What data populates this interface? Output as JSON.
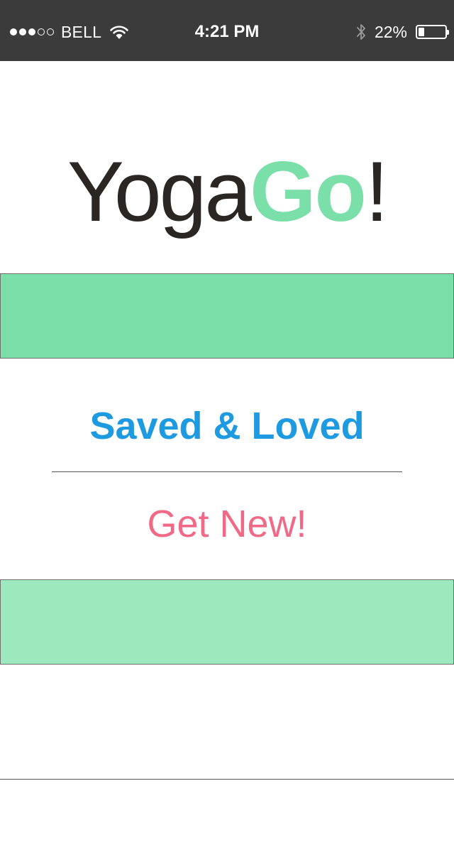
{
  "status_bar": {
    "signal_bars": 3,
    "signal_max": 5,
    "carrier": "BELL",
    "time": "4:21 PM",
    "battery_percent_label": "22%",
    "battery_level": 0.22,
    "icons": [
      "signal-icon",
      "wifi-icon",
      "bluetooth-icon",
      "battery-icon"
    ],
    "background_color": "#3b3b3b"
  },
  "logo": {
    "part1": "Yoga",
    "part2": "Go",
    "part3": "!",
    "text_color": "#2a2624",
    "accent_color": "#7adfa8"
  },
  "banners": {
    "top_color": "#7adfa8",
    "bottom_color": "#9ee8be"
  },
  "menu": {
    "saved_loved_label": "Saved & Loved",
    "saved_loved_color": "#1e9be0",
    "get_new_label": "Get New!",
    "get_new_color": "#f06a87"
  }
}
